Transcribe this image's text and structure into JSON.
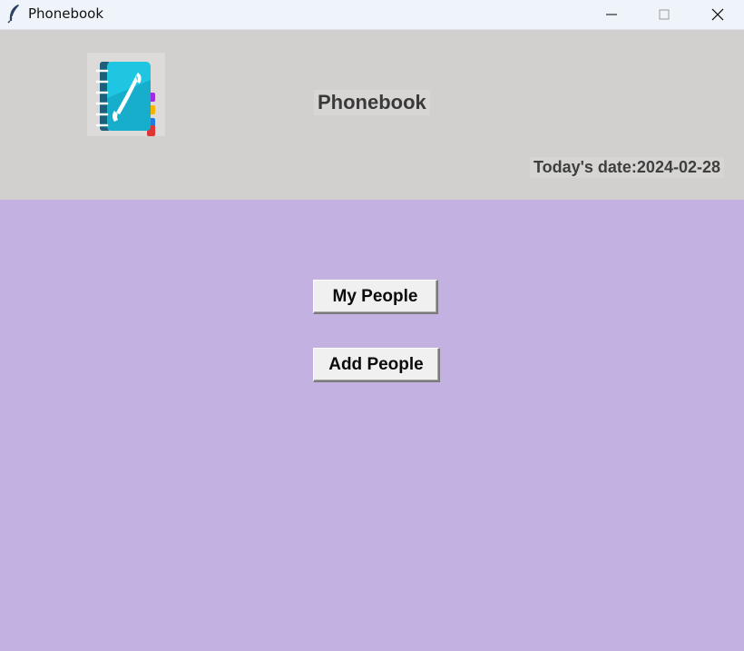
{
  "window": {
    "title": "Phonebook",
    "icon": "feather-icon",
    "controls": [
      "minimize-icon",
      "maximize-icon",
      "close-icon"
    ]
  },
  "header": {
    "logo_icon": "phonebook-icon",
    "title": "Phonebook",
    "date_text": "Today's date:2024-02-28"
  },
  "actions": {
    "my_people_label": "My People",
    "add_people_label": "Add People"
  },
  "colors": {
    "header_bg": "#d1d0cf",
    "body_bg": "#c3b1e1",
    "button_bg": "#f0f0f0",
    "logo_cyan": "#1fc6e2"
  }
}
